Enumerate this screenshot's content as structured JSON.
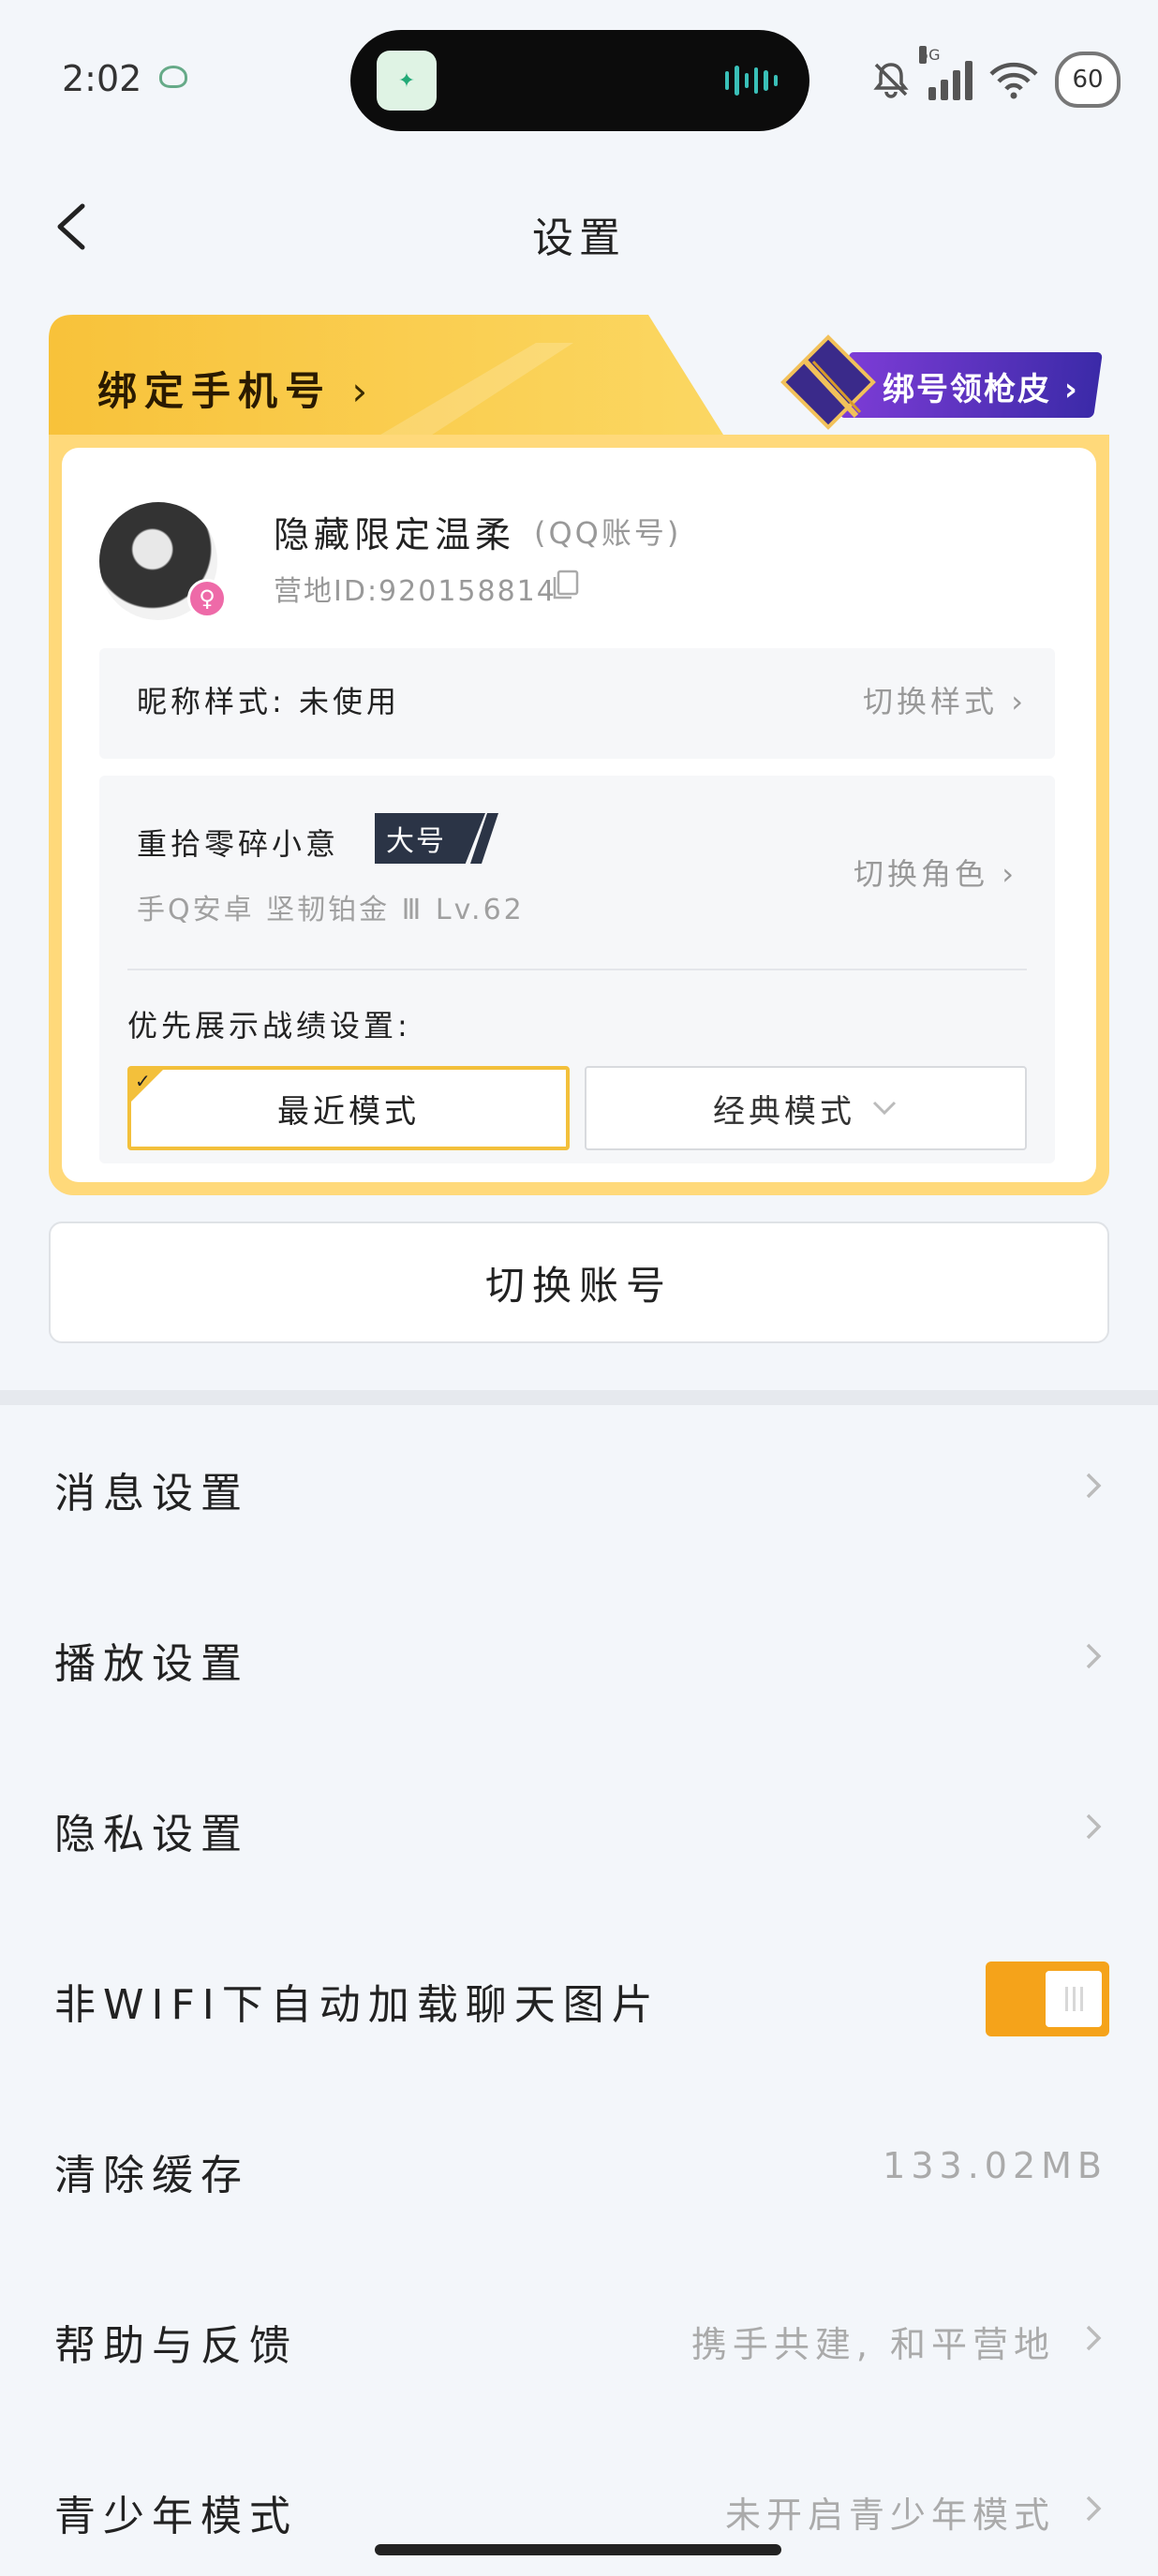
{
  "status_bar": {
    "time": "2:02",
    "network": "5G",
    "battery": "60"
  },
  "header": {
    "title": "设置"
  },
  "bind_banner": {
    "label": "绑定手机号",
    "promo_text": "绑号领枪皮"
  },
  "account": {
    "username": "隐藏限定温柔",
    "account_type": "(QQ账号)",
    "camp_id": "营地ID:920158814",
    "nickname_style_label": "昵称样式:  未使用",
    "nickname_style_action": "切换样式"
  },
  "role": {
    "name": "重拾零碎小意",
    "badge": "大号",
    "detail": "手Q安卓  坚韧铂金 Ⅲ  Lv.62",
    "switch_label": "切换角色",
    "preference_label": "优先展示战绩设置:",
    "modes": {
      "recent": "最近模式",
      "classic": "经典模式"
    }
  },
  "switch_account": "切换账号",
  "settings": {
    "message": {
      "label": "消息设置"
    },
    "playback": {
      "label": "播放设置"
    },
    "privacy": {
      "label": "隐私设置"
    },
    "auto_load": {
      "label": "非WIFI下自动加载聊天图片",
      "enabled": true
    },
    "cache": {
      "label": "清除缓存",
      "value": "133.02MB"
    },
    "help": {
      "label": "帮助与反馈",
      "value": "携手共建, 和平营地"
    },
    "teen": {
      "label": "青少年模式",
      "value": "未开启青少年模式"
    }
  },
  "colors": {
    "accent": "#f5a31a",
    "badge_bg": "#2b3446",
    "promo_bg": "#5a32c0"
  }
}
